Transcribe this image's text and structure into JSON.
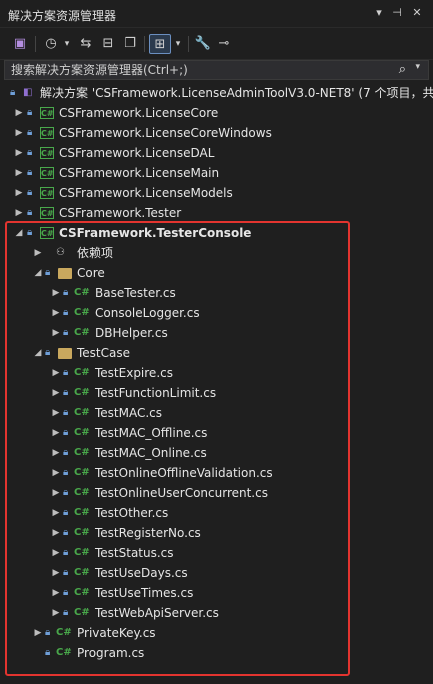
{
  "panel": {
    "title": "解决方案资源管理器",
    "controls": [
      "dropdown-icon",
      "pin-icon",
      "close-icon"
    ]
  },
  "toolbar": {
    "buttons": [
      "switch-view-icon",
      "history-icon",
      "dropdown-icon",
      "sync-icon",
      "collapse-icon",
      "show-all-files-icon",
      "preview-icon",
      "dropdown-icon",
      "properties-icon",
      "settings-icon"
    ]
  },
  "search": {
    "placeholder": "搜索解决方案资源管理器(Ctrl+;)"
  },
  "tree": {
    "solution": "解决方案 'CSFramework.LicenseAdminToolV3.0-NET8' (7 个项目，共",
    "projects": [
      {
        "label": "CSFramework.LicenseCore"
      },
      {
        "label": "CSFramework.LicenseCoreWindows"
      },
      {
        "label": "CSFramework.LicenseDAL"
      },
      {
        "label": "CSFramework.LicenseMain"
      },
      {
        "label": "CSFramework.LicenseModels"
      },
      {
        "label": "CSFramework.Tester"
      },
      {
        "label": "CSFramework.TesterConsole"
      }
    ],
    "dependencies": "依赖项",
    "core_folder": "Core",
    "core_files": [
      "BaseTester.cs",
      "ConsoleLogger.cs",
      "DBHelper.cs"
    ],
    "testcase_folder": "TestCase",
    "testcase_files": [
      "TestExpire.cs",
      "TestFunctionLimit.cs",
      "TestMAC.cs",
      "TestMAC_Offline.cs",
      "TestMAC_Online.cs",
      "TestOnlineOfflineValidation.cs",
      "TestOnlineUserConcurrent.cs",
      "TestOther.cs",
      "TestRegisterNo.cs",
      "TestStatus.cs",
      "TestUseDays.cs",
      "TestUseTimes.cs",
      "TestWebApiServer.cs"
    ],
    "root_files": [
      "PrivateKey.cs",
      "Program.cs"
    ],
    "cs_glyph": "C#",
    "proj_glyph": "C#"
  },
  "colors": {
    "highlight": "#e3342f",
    "csharp": "#49a84b",
    "folder": "#c9a85e",
    "lock": "#6f9fd8"
  }
}
